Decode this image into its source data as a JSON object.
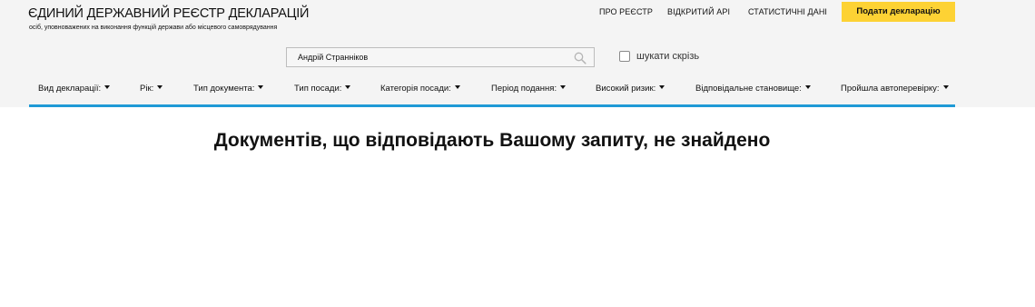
{
  "header": {
    "title": "ЄДИНИЙ ДЕРЖАВНИЙ РЕЄСТР ДЕКЛАРАЦІЙ",
    "subtitle": "осіб, уповноважених на виконання функцій держави або місцевого самоврядування"
  },
  "top_nav": {
    "about": "ПРО РЕЄСТР",
    "open_api": "ВІДКРИТИЙ API",
    "statistics": "СТАТИСТИЧНІ ДАНІ",
    "submit": "Подати декларацію"
  },
  "search": {
    "value": "Андрій Странніков",
    "everywhere_label": "шукати скрізь",
    "everywhere_checked": false
  },
  "filters": [
    "Вид декларації:",
    "Рік:",
    "Тип документа:",
    "Тип посади:",
    "Категорія посади:",
    "Період подання:",
    "Високий ризик:",
    "Відповідальне становище:",
    "Пройшла автоперевірку:"
  ],
  "results": {
    "message": "Документів, що відповідають Вашому запиту, не знайдено"
  },
  "colors": {
    "header_bg": "#f4f4f4",
    "accent_yellow": "#fdd234",
    "accent_blue": "#1f9ad6"
  },
  "icons": {
    "search": "search-icon",
    "dropdown": "caret-down-icon"
  }
}
